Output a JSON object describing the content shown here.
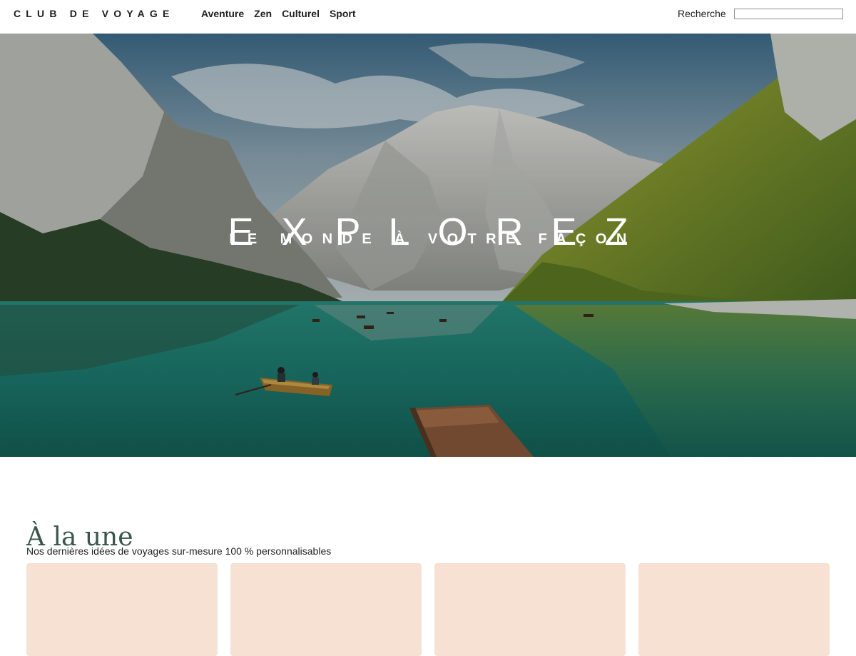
{
  "header": {
    "brand": "CLUB DE VOYAGE",
    "nav": [
      "Aventure",
      "Zen",
      "Culturel",
      "Sport"
    ],
    "search_label": "Recherche",
    "search_value": ""
  },
  "hero": {
    "title": "EXPLOREZ",
    "subtitle": "LE MONDE À VOTRE FAÇON"
  },
  "featured": {
    "title": "À la une",
    "subtitle": "Nos dernières idées de voyages sur-mesure 100 % personnalisables",
    "card_count": 4
  },
  "colors": {
    "accent_title": "#3a564c",
    "card_bg": "#f7e1d2",
    "lake": "#1f8478",
    "forest": "#8aa22a"
  }
}
